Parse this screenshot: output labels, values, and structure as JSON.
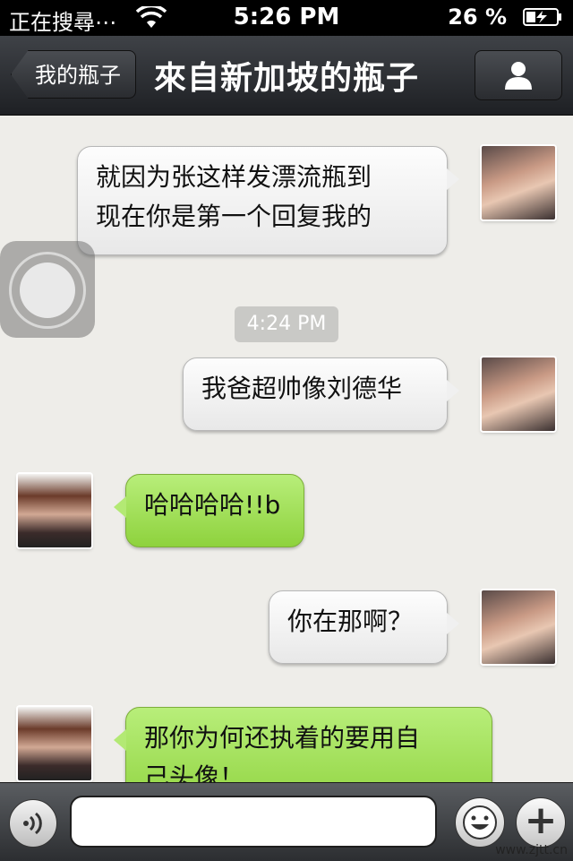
{
  "status_bar": {
    "carrier": "正在搜尋⋯",
    "time": "5:26 PM",
    "battery_percent": "26 %"
  },
  "nav": {
    "back_label": "我的瓶子",
    "title": "來自新加坡的瓶子"
  },
  "messages": [
    {
      "side": "right",
      "text_lines": [
        "就因为张这样发漂流瓶到",
        "现在你是第一个回复我的"
      ]
    },
    {
      "side": "right",
      "text": "我爸超帅像刘德华"
    },
    {
      "side": "left",
      "text": "哈哈哈哈!!b"
    },
    {
      "side": "right",
      "text": "你在那啊？"
    },
    {
      "side": "left",
      "text_lines": [
        "那你为何还执着的要用自",
        "己头像！"
      ]
    }
  ],
  "timestamp": "4:24 PM",
  "input": {
    "placeholder": "",
    "plus_label": "+"
  },
  "watermark": "www.zjtt.cn",
  "colors": {
    "green_bubble": "#9ee05a",
    "white_bubble": "#f4f4f4",
    "nav_bg": "#2c2e32"
  }
}
